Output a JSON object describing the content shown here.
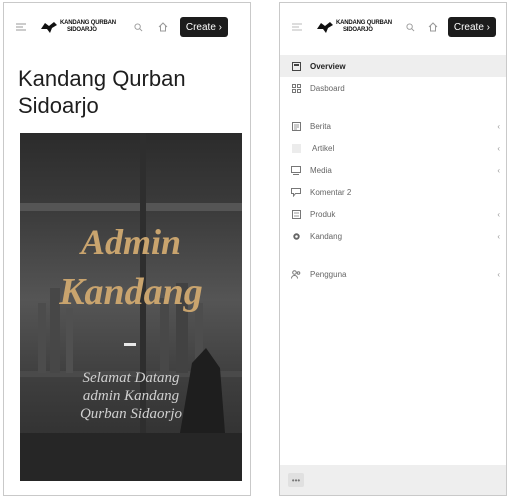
{
  "brand": {
    "line1": "KANDANG QURBAN",
    "line2": "SIDOARJO"
  },
  "toolbar": {
    "create_label": "Create ›"
  },
  "home": {
    "page_title_line1": "Kandang Qurban",
    "page_title_line2": "Sidoarjo",
    "hero": {
      "line1": "Admin",
      "line2": "Kandang",
      "welcome_line1": "Selamat Datang",
      "welcome_line2": "admin Kandang",
      "welcome_line3": "Qurban Sidaorjo"
    }
  },
  "sidebar": {
    "items": [
      {
        "label": "Overview",
        "icon": "overview-icon",
        "active": true
      },
      {
        "label": "Dasboard",
        "icon": "grid-icon"
      },
      {
        "label": "Berita",
        "icon": "news-icon",
        "has_submenu": true
      },
      {
        "label": "Artikel",
        "icon": "article-icon",
        "has_submenu": true
      },
      {
        "label": "Media",
        "icon": "media-icon",
        "has_submenu": true
      },
      {
        "label": "Komentar 2",
        "icon": "comment-icon"
      },
      {
        "label": "Produk",
        "icon": "product-icon",
        "has_submenu": true
      },
      {
        "label": "Kandang",
        "icon": "settings-icon",
        "has_submenu": true
      },
      {
        "label": "Pengguna",
        "icon": "users-icon",
        "has_submenu": true
      }
    ],
    "chevron": "‹",
    "footer_more": "•••"
  }
}
